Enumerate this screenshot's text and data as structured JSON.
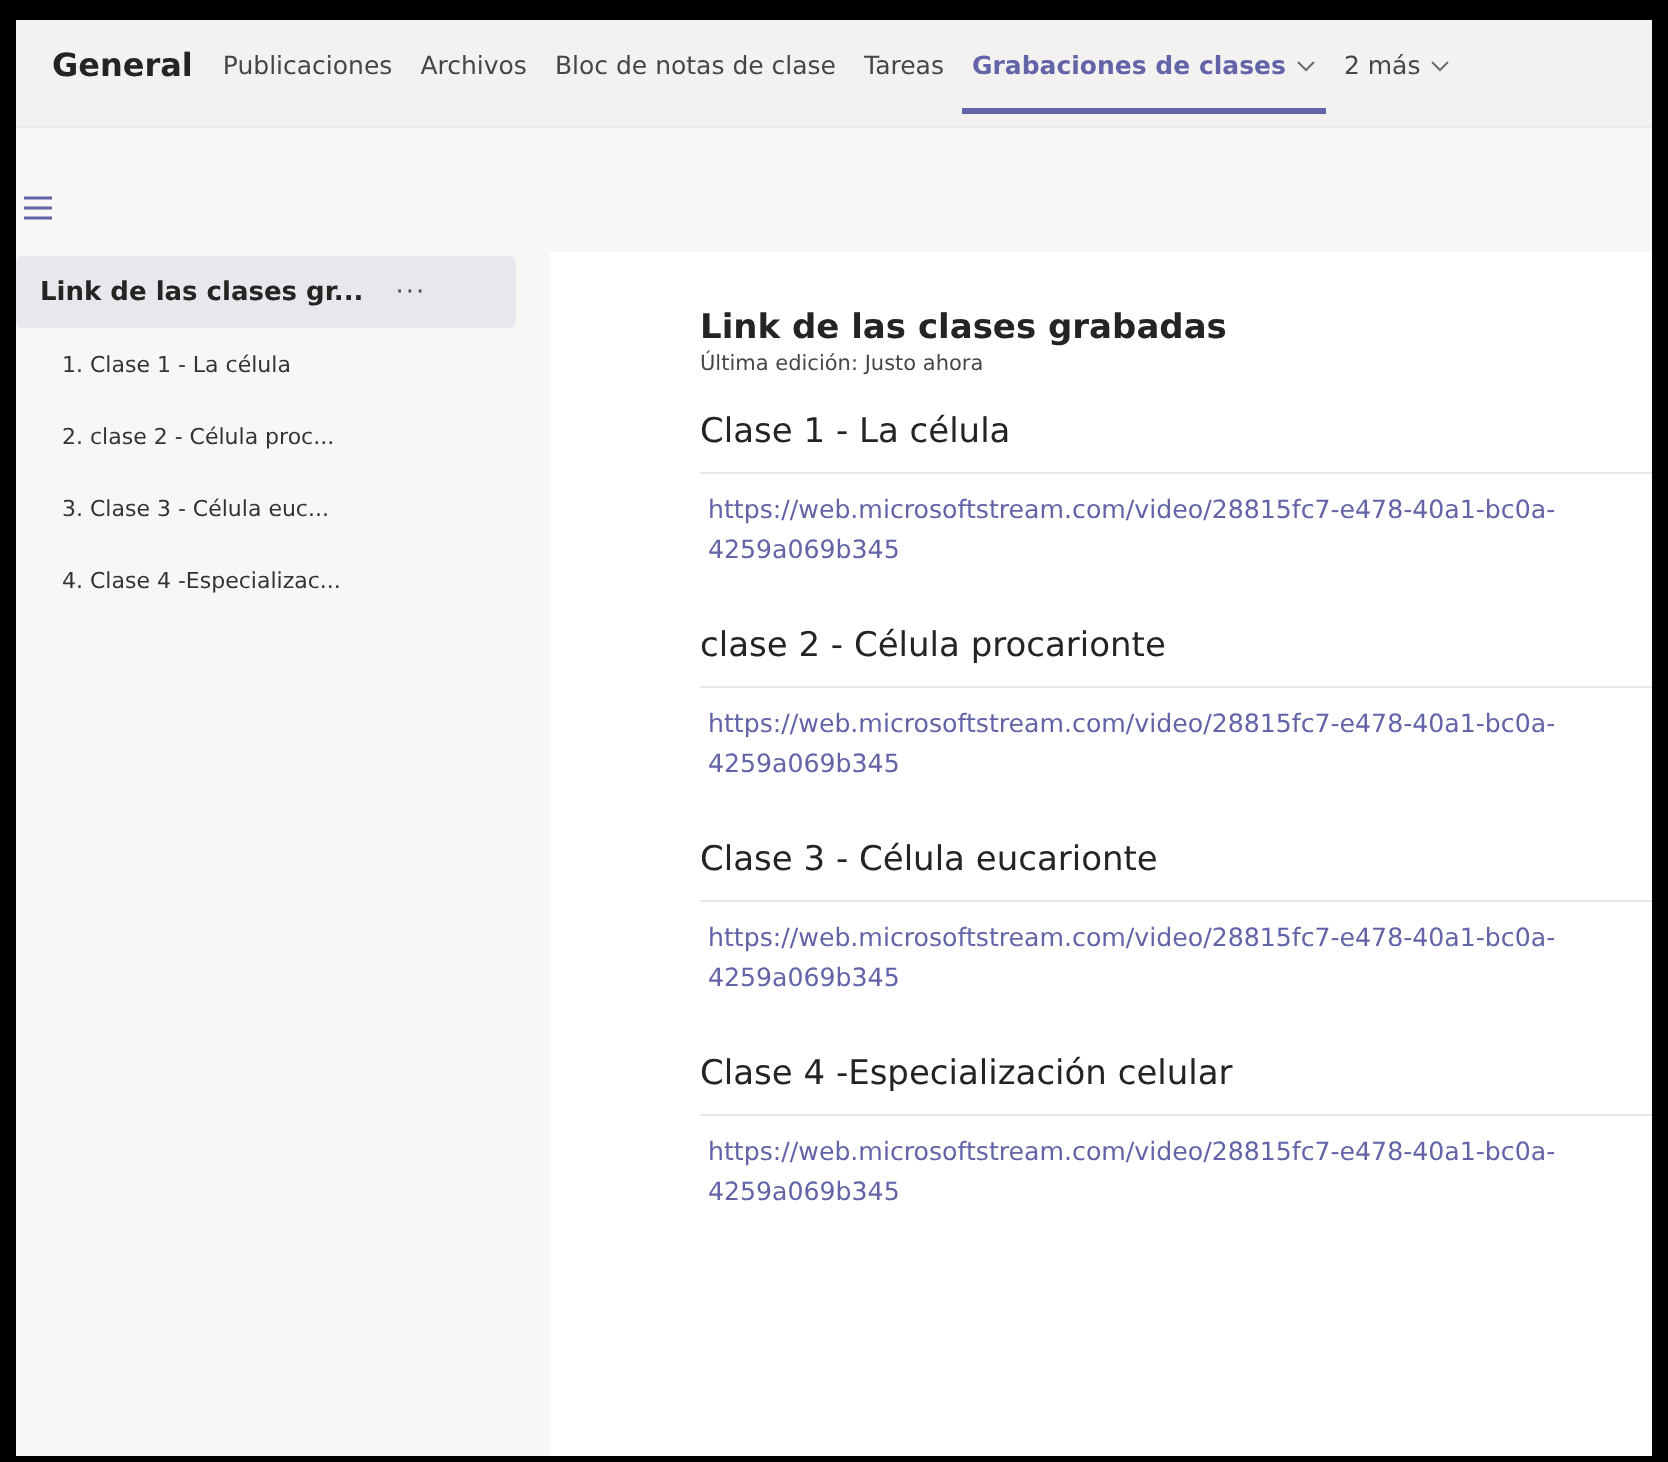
{
  "channel_title": "General",
  "tabs": [
    {
      "label": "Publicaciones",
      "kind": "tab",
      "selected": false,
      "dropdown": false
    },
    {
      "label": "Archivos",
      "kind": "tab",
      "selected": false,
      "dropdown": false
    },
    {
      "label": "Bloc de notas de clase",
      "kind": "tab",
      "selected": false,
      "dropdown": false
    },
    {
      "label": "Tareas",
      "kind": "tab",
      "selected": false,
      "dropdown": false
    },
    {
      "label": "Grabaciones de clases",
      "kind": "tab",
      "selected": true,
      "dropdown": true
    },
    {
      "label": "2 más",
      "kind": "tab",
      "selected": false,
      "dropdown": true
    }
  ],
  "sidebar": {
    "items": [
      {
        "label": "Link de las clases gr...",
        "selected": true,
        "more": "···"
      },
      {
        "label": "1. Clase 1 - La célula",
        "selected": false
      },
      {
        "label": "2. clase 2 - Célula proc...",
        "selected": false
      },
      {
        "label": "3. Clase 3 - Célula euc...",
        "selected": false
      },
      {
        "label": "4. Clase 4 -Especializac...",
        "selected": false
      }
    ]
  },
  "page": {
    "title": "Link de las clases grabadas",
    "edited": "Última edición: Justo ahora",
    "sections": [
      {
        "heading": "Clase 1 - La célula",
        "link": "https://web.microsoftstream.com/video/28815fc7-e478-40a1-bc0a-4259a069b345"
      },
      {
        "heading": "clase 2 - Célula procarionte",
        "link": "https://web.microsoftstream.com/video/28815fc7-e478-40a1-bc0a-4259a069b345"
      },
      {
        "heading": "Clase 3 - Célula eucarionte",
        "link": "https://web.microsoftstream.com/video/28815fc7-e478-40a1-bc0a-4259a069b345"
      },
      {
        "heading": "Clase 4 -Especialización celular",
        "link": "https://web.microsoftstream.com/video/28815fc7-e478-40a1-bc0a-4259a069b345"
      }
    ]
  }
}
